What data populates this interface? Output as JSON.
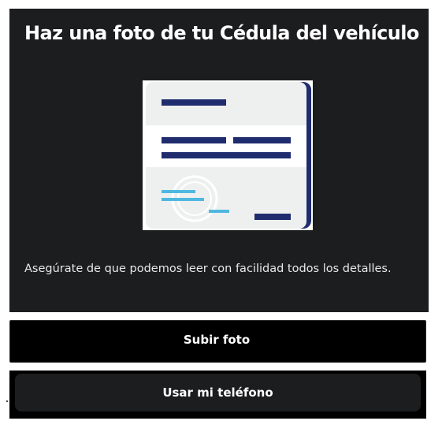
{
  "card": {
    "title": "Haz una foto de tu Cédula del vehículo",
    "description": "Asegúrate de que podemos leer con facilidad todos los detalles.",
    "illustration": "vehicle-registration-card-icon"
  },
  "actions": {
    "upload_label": "Subir foto",
    "phone_label": "Usar mi teléfono"
  },
  "colors": {
    "background": "#1c1d1f",
    "card_navy": "#1f2c6e",
    "card_accent": "#4fb8e0",
    "card_light": "#eef0ef",
    "button_primary": "#000000",
    "text": "#ffffff"
  }
}
